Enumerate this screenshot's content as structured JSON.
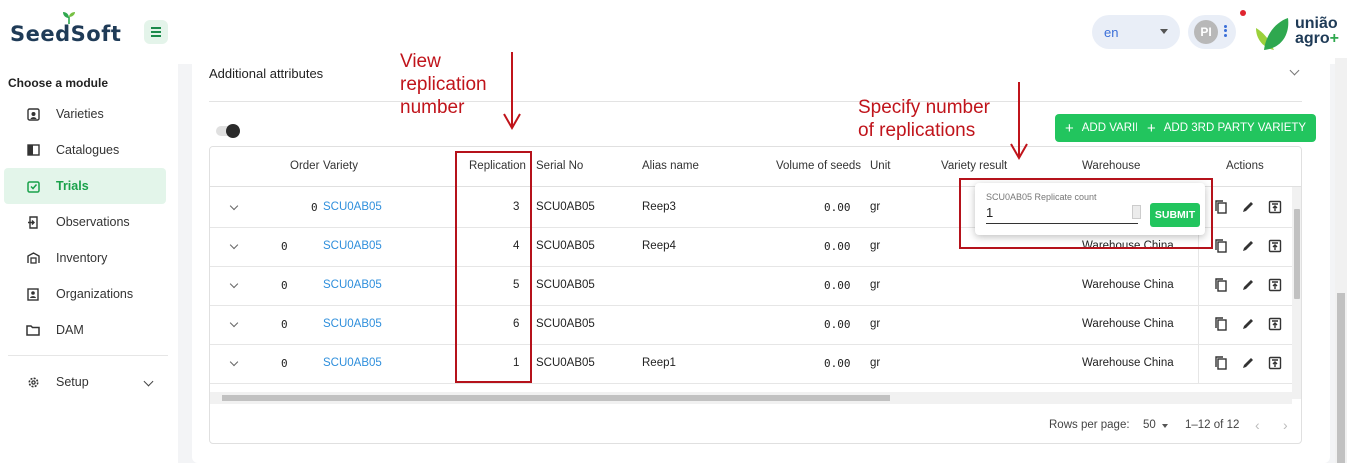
{
  "header": {
    "app_name": "SeedSoft",
    "language": "en",
    "avatar_initials": "PI",
    "partner_logo_line1": "união",
    "partner_logo_line2": "agro",
    "partner_logo_plus": "+"
  },
  "sidebar": {
    "title": "Choose a module",
    "items": [
      {
        "label": "Varieties",
        "icon": "varieties-icon"
      },
      {
        "label": "Catalogues",
        "icon": "catalogues-icon"
      },
      {
        "label": "Trials",
        "icon": "trials-icon",
        "active": true
      },
      {
        "label": "Observations",
        "icon": "observations-icon"
      },
      {
        "label": "Inventory",
        "icon": "inventory-icon"
      },
      {
        "label": "Organizations",
        "icon": "organizations-icon"
      },
      {
        "label": "DAM",
        "icon": "folder-icon"
      },
      {
        "label": "Setup",
        "icon": "gear-icon"
      }
    ]
  },
  "main": {
    "section_title": "Additional attributes",
    "add_variety_label": "ADD VARIETY",
    "add_third_party_label": "ADD 3RD PARTY VARIETY"
  },
  "table": {
    "columns": [
      "Order",
      "Variety",
      "Replication",
      "Serial No",
      "Alias name",
      "Volume of seeds",
      "Unit",
      "Variety result",
      "Warehouse",
      "Actions"
    ],
    "rows": [
      {
        "order": "0",
        "variety": "SCU0AB05",
        "replication": "3",
        "serial": "SCU0AB05",
        "alias": "Reep3",
        "volume": "0.00",
        "unit": "gr",
        "result": "",
        "warehouse": ""
      },
      {
        "order": "0",
        "variety": "SCU0AB05",
        "replication": "4",
        "serial": "SCU0AB05",
        "alias": "Reep4",
        "volume": "0.00",
        "unit": "gr",
        "result": "",
        "warehouse": "Warehouse China"
      },
      {
        "order": "0",
        "variety": "SCU0AB05",
        "replication": "5",
        "serial": "SCU0AB05",
        "alias": "",
        "volume": "0.00",
        "unit": "gr",
        "result": "",
        "warehouse": "Warehouse China"
      },
      {
        "order": "0",
        "variety": "SCU0AB05",
        "replication": "6",
        "serial": "SCU0AB05",
        "alias": "",
        "volume": "0.00",
        "unit": "gr",
        "result": "",
        "warehouse": "Warehouse China"
      },
      {
        "order": "0",
        "variety": "SCU0AB05",
        "replication": "1",
        "serial": "SCU0AB05",
        "alias": "Reep1",
        "volume": "0.00",
        "unit": "gr",
        "result": "",
        "warehouse": "Warehouse China"
      }
    ],
    "rows_per_page_label": "Rows per page:",
    "rows_per_page_value": "50",
    "range_label": "1–12 of 12"
  },
  "popup": {
    "label": "SCU0AB05 Replicate count",
    "value": "1",
    "submit_label": "SUBMIT"
  },
  "annotations": {
    "view_replication": "View\nreplication\nnumber",
    "specify_replications": "Specify number\nof replications",
    "color": "#c0141b"
  }
}
